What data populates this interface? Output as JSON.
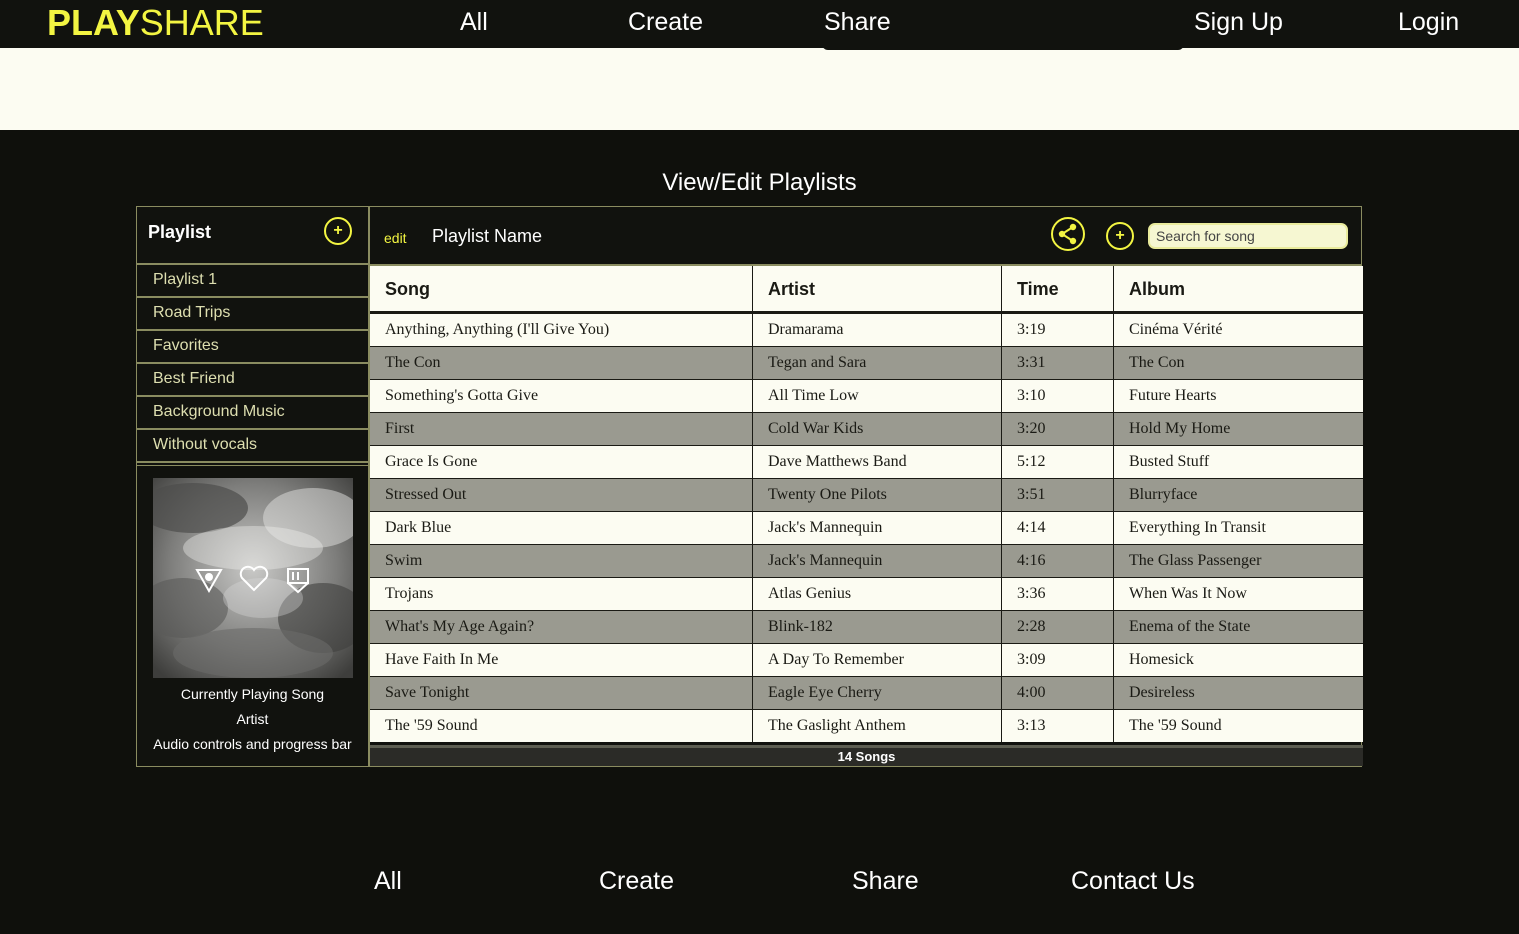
{
  "brand": {
    "bold": "PLAY",
    "light": "SHARE"
  },
  "nav": {
    "all": "All",
    "create": "Create",
    "share": "Share",
    "signup": "Sign Up",
    "login": "Login"
  },
  "heading": "View/Edit Playlists",
  "sidebar": {
    "title": "Playlist",
    "add_symbol": "+",
    "playlists": [
      "Playlist 1",
      "Road Trips",
      "Favorites",
      "Best Friend",
      "Background Music",
      "Without vocals"
    ],
    "now_playing": {
      "song": "Currently Playing Song",
      "artist": "Artist",
      "controls": "Audio controls and progress bar"
    }
  },
  "main": {
    "edit_label": "edit",
    "playlist_name": "Playlist Name",
    "add_symbol": "+",
    "search_placeholder": "Search for song",
    "columns": [
      "Song",
      "Artist",
      "Time",
      "Album"
    ],
    "rows": [
      [
        "Anything, Anything (I'll Give You)",
        "Dramarama",
        "3:19",
        "Cinéma Vérité"
      ],
      [
        "The Con",
        "Tegan and Sara",
        "3:31",
        "The Con"
      ],
      [
        "Something's Gotta Give",
        "All Time Low",
        "3:10",
        "Future Hearts"
      ],
      [
        "First",
        "Cold War Kids",
        "3:20",
        "Hold My Home"
      ],
      [
        "Grace Is Gone",
        "Dave Matthews Band",
        "5:12",
        "Busted Stuff"
      ],
      [
        "Stressed Out",
        "Twenty One Pilots",
        "3:51",
        "Blurryface"
      ],
      [
        "Dark Blue",
        "Jack's Mannequin",
        "4:14",
        "Everything In Transit"
      ],
      [
        "Swim",
        "Jack's Mannequin",
        "4:16",
        "The Glass Passenger"
      ],
      [
        "Trojans",
        "Atlas Genius",
        "3:36",
        "When Was It Now"
      ],
      [
        "What's My Age Again?",
        "Blink-182",
        "2:28",
        "Enema of the State"
      ],
      [
        "Have Faith In Me",
        "A Day To Remember",
        "3:09",
        "Homesick"
      ],
      [
        "Save Tonight",
        "Eagle Eye Cherry",
        "4:00",
        "Desireless"
      ],
      [
        "The '59 Sound",
        "The Gaslight Anthem",
        "3:13",
        "The '59 Sound"
      ]
    ],
    "song_count": "14 Songs"
  },
  "footer": {
    "all": "All",
    "create": "Create",
    "share": "Share",
    "contact": "Contact Us"
  },
  "colors": {
    "accent": "#f3f542",
    "background": "#0f100c",
    "cream": "#fcfcf2",
    "border": "#8a8c60",
    "row_alt": "#9a9a90"
  },
  "icons": {
    "share": "share-icon",
    "add": "plus-icon",
    "album_symbols": [
      "triangle-eye-icon",
      "heart-icon",
      "box-icon"
    ]
  }
}
